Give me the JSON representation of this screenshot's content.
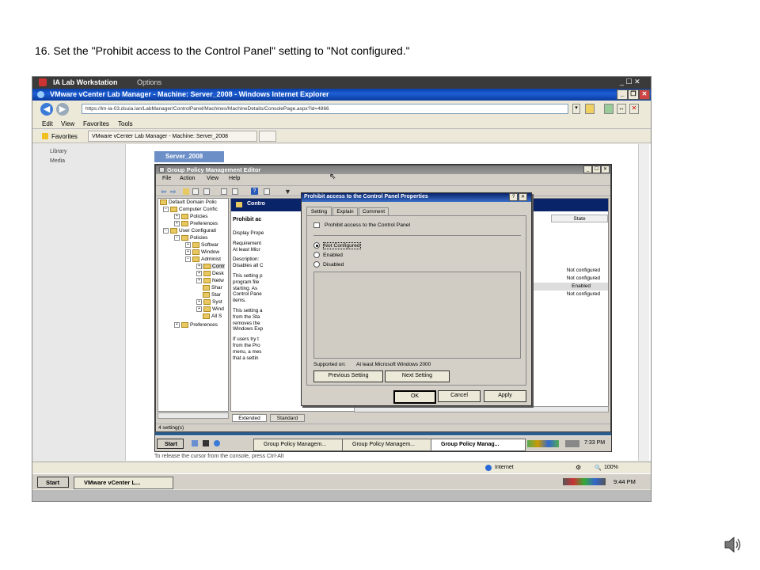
{
  "caption": "16. Set the \"Prohibit access to the Control Panel\" setting to \"Not configured.\"",
  "workstation": {
    "title": "IA Lab Workstation",
    "options": "Options"
  },
  "ie": {
    "title": "VMware vCenter Lab Manager - Machine: Server_2008 - Windows Internet Explorer",
    "url": "https://lm-ia-03.dsuia.lan/LabManager/ControlPanel/Machines/MachineDetails/ConsolePage.aspx?id=4866",
    "menu": [
      "Edit",
      "View",
      "Favorites",
      "Tools"
    ],
    "favorites": "Favorites",
    "fav_tab": "VMware vCenter Lab Manager - Machine: Server_2008"
  },
  "left_nav": [
    "Library",
    "Media"
  ],
  "server_tab": "Server_2008",
  "gpme": {
    "title": "Group Policy Management Editor",
    "menu": [
      "File",
      "Action",
      "View",
      "Help"
    ],
    "tree": [
      "Default Domain Polic",
      "Computer Confic",
      "Policies",
      "Preferences",
      "User Configurati",
      "Policies",
      "Softwar",
      "Window",
      "Administ",
      "Contr",
      "Desk",
      "Netw",
      "Shar",
      "Star",
      "Syst",
      "Wind",
      "All S",
      "Preferences"
    ],
    "header": "Contro",
    "desc_heading": "Prohibit ac",
    "desc_lines": [
      "Display Prope",
      "Requirement",
      "At least Micr",
      "Description:",
      "Disables all C",
      "This setting p",
      "program file",
      "starting. As",
      "Control Pane",
      "items.",
      "This setting a",
      "from the Sta",
      "removes the",
      "Windows Exp",
      "If users try t",
      "from the Pro",
      "menu, a mes",
      "that a settin"
    ],
    "state_header": "State",
    "states": [
      "Not configured",
      "Not configured",
      "Enabled",
      "Not configured"
    ],
    "tabs": [
      "Extended",
      "Standard"
    ],
    "status": "4 setting(s)"
  },
  "dialog": {
    "title": "Prohibit access to the Control Panel Properties",
    "tabs": [
      "Setting",
      "Explain",
      "Comment"
    ],
    "policy_name": "Prohibit access to the Control Panel",
    "options": [
      "Not Configured",
      "Enabled",
      "Disabled"
    ],
    "supported_label": "Supported on:",
    "supported_value": "At least Microsoft Windows 2000",
    "prev": "Previous Setting",
    "next": "Next Setting",
    "ok": "OK",
    "cancel": "Cancel",
    "apply": "Apply"
  },
  "vm_taskbar": {
    "start": "Start",
    "items": [
      "Group Policy Managem...",
      "Group Policy Managem...",
      "Group Policy Manag..."
    ],
    "time": "7:33 PM"
  },
  "release_hint": "To release the cursor from the console, press Ctrl-Alt",
  "ie_status": {
    "zone": "Internet",
    "zoom": "100%"
  },
  "host_taskbar": {
    "start": "Start",
    "item": "VMware vCenter L...",
    "time": "9:44 PM"
  }
}
